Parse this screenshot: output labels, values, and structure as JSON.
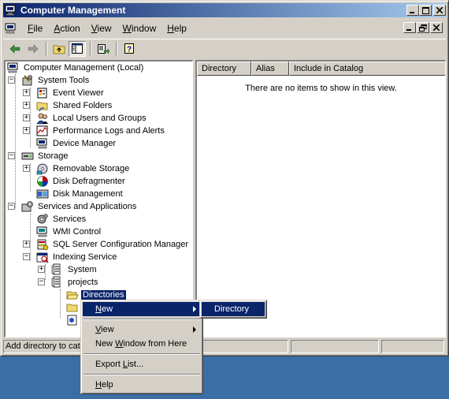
{
  "window": {
    "title": "Computer Management"
  },
  "menubar": {
    "items": [
      "File",
      "Action",
      "View",
      "Window",
      "Help"
    ]
  },
  "tree": {
    "root": "Computer Management (Local)",
    "system_tools": "System Tools",
    "event_viewer": "Event Viewer",
    "shared_folders": "Shared Folders",
    "local_users": "Local Users and Groups",
    "perf_logs": "Performance Logs and Alerts",
    "device_manager": "Device Manager",
    "storage": "Storage",
    "removable_storage": "Removable Storage",
    "disk_defrag": "Disk Defragmenter",
    "disk_mgmt": "Disk Management",
    "services_apps": "Services and Applications",
    "services": "Services",
    "wmi_control": "WMI Control",
    "sql_config": "SQL Server Configuration Manager",
    "indexing_service": "Indexing Service",
    "system_catalog": "System",
    "projects_catalog": "projects",
    "directories": "Directories"
  },
  "list": {
    "columns": [
      "Directory",
      "Alias",
      "Include in Catalog"
    ],
    "empty_message": "There are no items to show in this view."
  },
  "status": {
    "text": "Add directory to cata"
  },
  "context_menu": {
    "new": "New",
    "view": "View",
    "new_window": "New Window from Here",
    "export_list": "Export List...",
    "help": "Help"
  },
  "submenu": {
    "directory": "Directory"
  },
  "colors": {
    "title_start": "#0a246a",
    "title_end": "#a6caf0",
    "highlight": "#0a246a",
    "desktop": "#3a6ea5"
  }
}
